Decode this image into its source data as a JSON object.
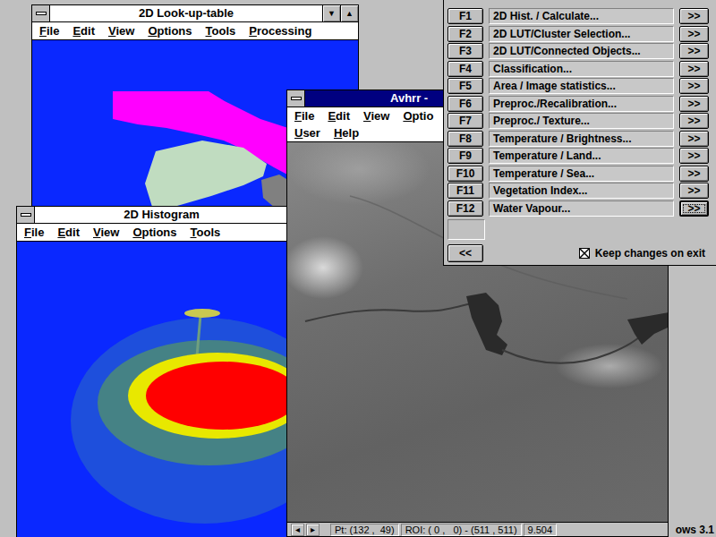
{
  "desktop": {
    "watermark": "ows 3.1"
  },
  "lut_window": {
    "title": "2D Look-up-table",
    "active": false,
    "controls": [
      "▼",
      "▲"
    ],
    "menu_rows": [
      [
        "File",
        "Edit",
        "View",
        "Options",
        "Tools",
        "Processing"
      ]
    ]
  },
  "histogram_window": {
    "title": "2D Histogram",
    "active": false,
    "controls": [],
    "menu_rows": [
      [
        "File",
        "Edit",
        "View",
        "Options",
        "Tools"
      ]
    ]
  },
  "image_window": {
    "title": "Avhrr -",
    "active": true,
    "controls": [],
    "menu_rows": [
      [
        "File",
        "Edit",
        "View",
        "Optio"
      ],
      [
        "User",
        "Help"
      ]
    ],
    "status_bar": {
      "arrows": [
        "◂",
        "▸"
      ],
      "point": "Pt: (132 ,  49)",
      "roi": "ROI: ( 0 ,   0) - (511 , 511)",
      "value": "9.504"
    }
  },
  "function_panel": {
    "items": [
      {
        "key": "F1",
        "label": "2D Hist. / Calculate...",
        "button": ">>",
        "focused": false
      },
      {
        "key": "F2",
        "label": "2D LUT/Cluster Selection...",
        "button": ">>",
        "focused": false
      },
      {
        "key": "F3",
        "label": "2D LUT/Connected Objects...",
        "button": ">>",
        "focused": false
      },
      {
        "key": "F4",
        "label": "Classification...",
        "button": ">>",
        "focused": false
      },
      {
        "key": "F5",
        "label": "Area / Image statistics...",
        "button": ">>",
        "focused": false
      },
      {
        "key": "F6",
        "label": "Preproc./Recalibration...",
        "button": ">>",
        "focused": false
      },
      {
        "key": "F7",
        "label": "Preproc./ Texture...",
        "button": ">>",
        "focused": false
      },
      {
        "key": "F8",
        "label": "Temperature / Brightness...",
        "button": ">>",
        "focused": false
      },
      {
        "key": "F9",
        "label": "Temperature / Land...",
        "button": ">>",
        "focused": false
      },
      {
        "key": "F10",
        "label": "Temperature / Sea...",
        "button": ">>",
        "focused": false
      },
      {
        "key": "F11",
        "label": "Vegetation Index...",
        "button": ">>",
        "focused": false
      },
      {
        "key": "F12",
        "label": "Water Vapour...",
        "button": ">>",
        "focused": true
      }
    ],
    "back_button": "<<",
    "keep_changes": {
      "label": "Keep changes on exit",
      "checked": true
    }
  }
}
